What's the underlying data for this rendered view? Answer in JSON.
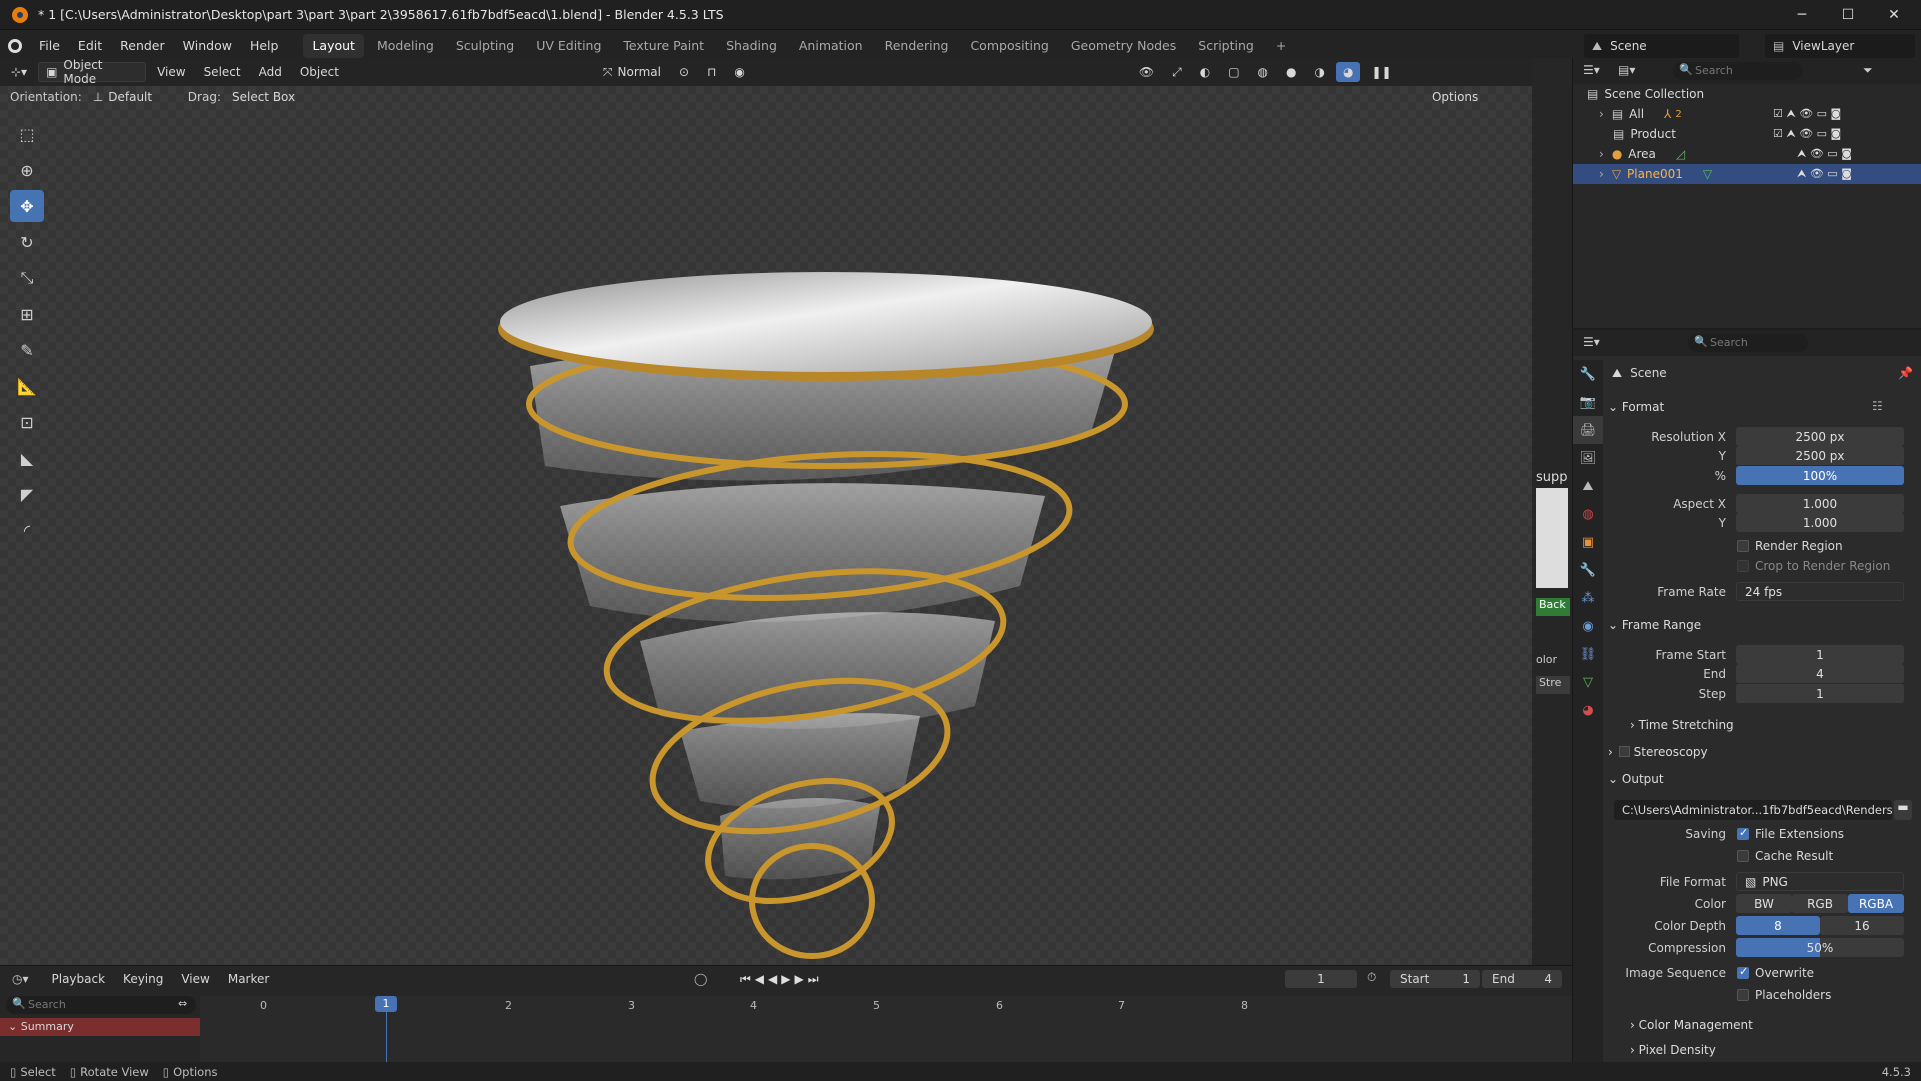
{
  "window": {
    "title": "* 1 [C:\\Users\\Administrator\\Desktop\\part 3\\part 3\\part 2\\3958617.61fb7bdf5eacd\\1.blend] - Blender 4.5.3 LTS",
    "min": "─",
    "max": "☐",
    "close": "✕"
  },
  "menu": [
    "File",
    "Edit",
    "Render",
    "Window",
    "Help"
  ],
  "workspaces": [
    "Layout",
    "Modeling",
    "Sculpting",
    "UV Editing",
    "Texture Paint",
    "Shading",
    "Animation",
    "Rendering",
    "Compositing",
    "Geometry Nodes",
    "Scripting"
  ],
  "workspace_add": "+",
  "scene_selector": "Scene",
  "viewlayer_selector": "ViewLayer",
  "viewport_header": {
    "mode": "Object Mode",
    "view": "View",
    "select": "Select",
    "add": "Add",
    "object": "Object",
    "transform_orientation": "Normal",
    "orientation_label": "Orientation:",
    "orientation_value": "Default",
    "drag_label": "Drag:",
    "drag_value": "Select Box",
    "options": "Options"
  },
  "viewport_edge_text": {
    "supp": "supp",
    "back": "Back",
    "olor": "olor",
    "stre": "Stre"
  },
  "outliner": {
    "search_placeholder": "Search",
    "root": "Scene Collection",
    "items": [
      {
        "name": "All",
        "badge": "2"
      },
      {
        "name": "Product"
      },
      {
        "name": "Area"
      },
      {
        "name": "Plane001",
        "selected": true
      }
    ]
  },
  "properties": {
    "search_placeholder": "Search",
    "context": "Scene",
    "format": {
      "title": "Format",
      "res_x_label": "Resolution X",
      "res_x": "2500 px",
      "res_y_label": "Y",
      "res_y": "2500 px",
      "pct_label": "%",
      "pct": "100%",
      "aspect_x_label": "Aspect X",
      "aspect_x": "1.000",
      "aspect_y_label": "Y",
      "aspect_y": "1.000",
      "render_region": "Render Region",
      "crop": "Crop to Render Region",
      "frame_rate_label": "Frame Rate",
      "frame_rate": "24 fps"
    },
    "frame_range": {
      "title": "Frame Range",
      "start_label": "Frame Start",
      "start": "1",
      "end_label": "End",
      "end": "4",
      "step_label": "Step",
      "step": "1",
      "time_stretching": "Time Stretching"
    },
    "stereoscopy": "Stereoscopy",
    "output": {
      "title": "Output",
      "path": "C:\\Users\\Administrator...1fb7bdf5eacd\\Renders",
      "saving_label": "Saving",
      "file_ext": "File Extensions",
      "cache": "Cache Result",
      "format_label": "File Format",
      "format": "PNG",
      "color_label": "Color",
      "bw": "BW",
      "rgb": "RGB",
      "rgba": "RGBA",
      "depth_label": "Color Depth",
      "depth8": "8",
      "depth16": "16",
      "compression_label": "Compression",
      "compression": "50%",
      "compression_fraction": 0.5,
      "seq_label": "Image Sequence",
      "overwrite": "Overwrite",
      "placeholders": "Placeholders"
    },
    "color_management": "Color Management",
    "pixel_density": "Pixel Density"
  },
  "timeline": {
    "playback": "Playback",
    "keying": "Keying",
    "view": "View",
    "marker": "Marker",
    "current": "1",
    "start_label": "Start",
    "start": "1",
    "end_label": "End",
    "end": "4",
    "search_placeholder": "Search",
    "summary": "Summary",
    "ruler": [
      "0",
      "1",
      "2",
      "3",
      "4",
      "5",
      "6",
      "7",
      "8"
    ]
  },
  "status": {
    "select": "Select",
    "rotate": "Rotate View",
    "options": "Options",
    "version": "4.5.3"
  },
  "colors": {
    "accent": "#4772b3",
    "selected_text": "#ffb143",
    "gold": "#c9962e"
  }
}
